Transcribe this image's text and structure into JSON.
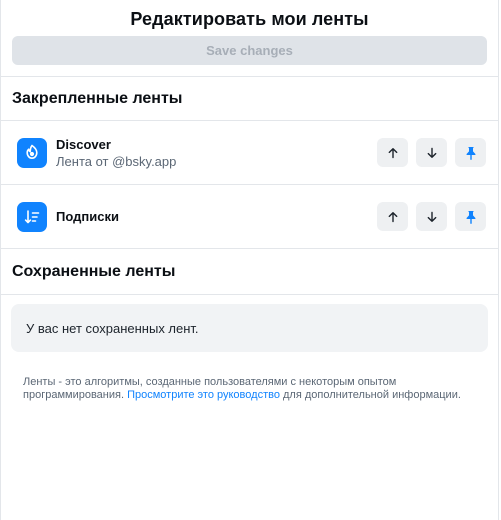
{
  "header": {
    "title": "Редактировать мои ленты",
    "save_label": "Save changes"
  },
  "pinned": {
    "title": "Закрепленные ленты",
    "items": [
      {
        "name": "Discover",
        "subtitle": "Лента от @bsky.app",
        "icon": "butterfly-icon"
      },
      {
        "name": "Подписки",
        "subtitle": "",
        "icon": "sort-list-icon"
      }
    ]
  },
  "saved": {
    "title": "Сохраненные ленты",
    "empty_text": "У вас нет сохраненных лент."
  },
  "info": {
    "before": "Ленты - это алгоритмы, созданные пользователями с некоторым опытом программирования. ",
    "link": "Просмотрите это руководство",
    "after": " для дополнительной информации."
  },
  "colors": {
    "accent": "#1083fe",
    "disabled_button": "#dfe3e8",
    "action_button": "#eef0f2"
  }
}
